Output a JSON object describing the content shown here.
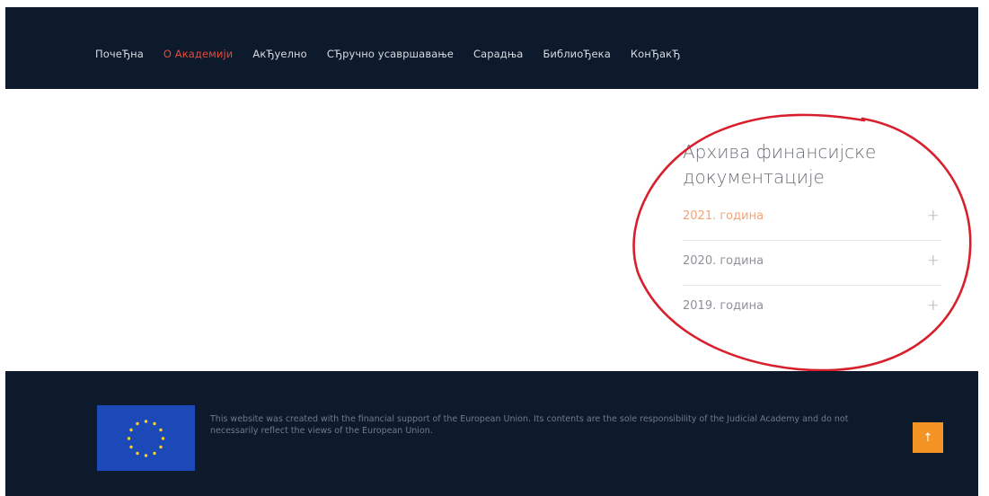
{
  "nav": {
    "items": [
      {
        "label": "ПочеЂна",
        "active": false
      },
      {
        "label": "О Академији",
        "active": true
      },
      {
        "label": "АкЂуелно",
        "active": false
      },
      {
        "label": "СЂручно усавршавање",
        "active": false
      },
      {
        "label": "Сарадња",
        "active": false
      },
      {
        "label": "БиблиоЂека",
        "active": false
      },
      {
        "label": "КонЂакЂ",
        "active": false
      }
    ]
  },
  "archive": {
    "title": "Архива финансијске документације",
    "items": [
      {
        "label": "2021. година",
        "active": true,
        "icon": "plus-icon"
      },
      {
        "label": "2020. година",
        "active": false,
        "icon": "plus-icon"
      },
      {
        "label": "2019. година",
        "active": false,
        "icon": "plus-icon"
      }
    ]
  },
  "footer": {
    "text": "This website was created with the financial support of the European Union. Its contents are the sole responsibility of the Judicial Academy and do not necessarily reflect the views of the European Union.",
    "back_to_top_icon": "arrow-up-icon",
    "flag_icon": "eu-flag-icon"
  },
  "colors": {
    "nav_bg": "#0d1a2b",
    "accent_red": "#e44b3c",
    "accent_orange": "#f2a477",
    "back_to_top": "#f29324",
    "annotation": "#d8202d"
  }
}
